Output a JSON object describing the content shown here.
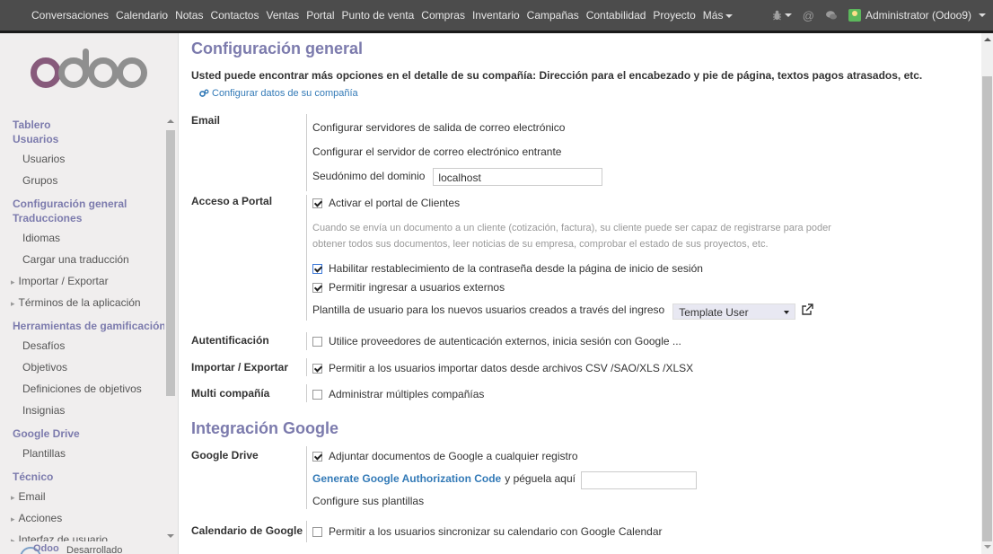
{
  "topbar": {
    "menu": [
      "Conversaciones",
      "Calendario",
      "Notas",
      "Contactos",
      "Ventas",
      "Portal",
      "Punto de venta",
      "Compras",
      "Inventario",
      "Campañas",
      "Contabilidad",
      "Proyecto",
      "Más"
    ],
    "icons": [
      "bug-icon",
      "at-icon",
      "chat-icon"
    ],
    "user": "Administrator (Odoo9)"
  },
  "sidebar": {
    "logo_text": "odoo",
    "sections": [
      {
        "head": "Tablero",
        "items": []
      },
      {
        "head": "Usuarios",
        "items": [
          {
            "label": "Usuarios",
            "arrow": false
          },
          {
            "label": "Grupos",
            "arrow": false
          }
        ]
      },
      {
        "head": "Configuración general",
        "items": []
      },
      {
        "head": "Traducciones",
        "items": [
          {
            "label": "Idiomas",
            "arrow": false
          },
          {
            "label": "Cargar una traducción",
            "arrow": false
          },
          {
            "label": "Importar / Exportar",
            "arrow": true
          },
          {
            "label": "Términos de la aplicación",
            "arrow": true
          }
        ]
      },
      {
        "head": "Herramientas de gamificación",
        "items": [
          {
            "label": "Desafíos",
            "arrow": false
          },
          {
            "label": "Objetivos",
            "arrow": false
          },
          {
            "label": "Definiciones de objetivos",
            "arrow": false
          },
          {
            "label": "Insignias",
            "arrow": false
          }
        ]
      },
      {
        "head": "Google Drive",
        "items": [
          {
            "label": "Plantillas",
            "arrow": false
          }
        ]
      },
      {
        "head": "Técnico",
        "items": [
          {
            "label": "Email",
            "arrow": true
          },
          {
            "label": "Acciones",
            "arrow": true
          },
          {
            "label": "Interfaz de usuario",
            "arrow": true
          }
        ]
      }
    ],
    "powered_prefix": "Desarrollado por",
    "powered_brand": "Odoo"
  },
  "main": {
    "title_general": "Configuración general",
    "intro": "Usted puede encontrar más opciones en el detalle de su compañía: Dirección para el encabezado y pie de página, textos pagos atrasados, etc.",
    "configure_company": "Configurar datos de su compañía",
    "email": {
      "label": "Email",
      "outgoing_link": "Configurar servidores de salida de correo electrónico",
      "incoming_link": "Configurar el servidor de correo electrónico entrante",
      "alias_label": "Seudónimo del dominio",
      "alias_value": "localhost"
    },
    "portal": {
      "label": "Acceso a Portal",
      "enable_portal": "Activar el portal de Clientes",
      "help": "Cuando se envía un documento a un cliente (cotización, factura), su cliente puede ser capaz de registrarse para poder obtener todos sus documentos, leer noticias de su empresa, comprobar el estado de sus proyectos, etc.",
      "reset_password": "Habilitar restablecimiento de la contraseña desde la página de inicio de sesión",
      "external_users": "Permitir ingresar a usuarios externos",
      "template_label": "Plantilla de usuario para los nuevos usuarios creados a través del ingreso",
      "template_value": "Template User"
    },
    "auth": {
      "label": "Autentificación",
      "text": "Utilice proveedores de autenticación externos, inicia sesión con Google ..."
    },
    "import": {
      "label": "Importar / Exportar",
      "text": "Permitir a los usuarios importar datos desde archivos CSV /SAO/XLS /XLSX"
    },
    "multi": {
      "label": "Multi compañía",
      "text": "Administrar múltiples compañías"
    },
    "title_google": "Integración Google",
    "gdrive": {
      "label": "Google Drive",
      "attach": "Adjuntar documentos de Google a cualquier registro",
      "auth_link": "Generate Google Authorization Code",
      "paste_text": "y péguela aquí",
      "templates_link": "Configure sus plantillas"
    },
    "gcal": {
      "label": "Calendario de Google",
      "text": "Permitir a los usuarios sincronizar su calendario con Google Calendar"
    }
  },
  "colors": {
    "accent": "#7c7bad",
    "link": "#337ab7",
    "topbar": "#4c4c4c"
  }
}
